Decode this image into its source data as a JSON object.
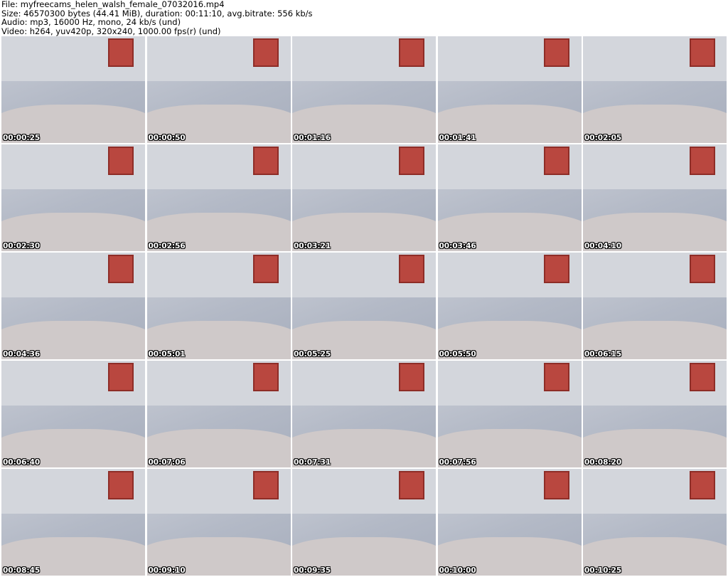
{
  "header": {
    "file": "File: myfreecams_helen_walsh_female_07032016.mp4",
    "size": "Size: 46570300 bytes (44.41 MiB), duration: 00:11:10, avg.bitrate: 556 kb/s",
    "audio": "Audio: mp3, 16000 Hz, mono, 24 kb/s (und)",
    "video": "Video: h264, yuv420p, 320x240, 1000.00 fps(r) (und)"
  },
  "thumbnails": [
    {
      "time": "00:00:25"
    },
    {
      "time": "00:00:50"
    },
    {
      "time": "00:01:16"
    },
    {
      "time": "00:01:41"
    },
    {
      "time": "00:02:05"
    },
    {
      "time": "00:02:30"
    },
    {
      "time": "00:02:56"
    },
    {
      "time": "00:03:21"
    },
    {
      "time": "00:03:46"
    },
    {
      "time": "00:04:10"
    },
    {
      "time": "00:04:36"
    },
    {
      "time": "00:05:01"
    },
    {
      "time": "00:05:25"
    },
    {
      "time": "00:05:50"
    },
    {
      "time": "00:06:15"
    },
    {
      "time": "00:06:40"
    },
    {
      "time": "00:07:06"
    },
    {
      "time": "00:07:31"
    },
    {
      "time": "00:07:56"
    },
    {
      "time": "00:08:20"
    },
    {
      "time": "00:08:45"
    },
    {
      "time": "00:09:10"
    },
    {
      "time": "00:09:35"
    },
    {
      "time": "00:10:00"
    },
    {
      "time": "00:10:25"
    }
  ]
}
